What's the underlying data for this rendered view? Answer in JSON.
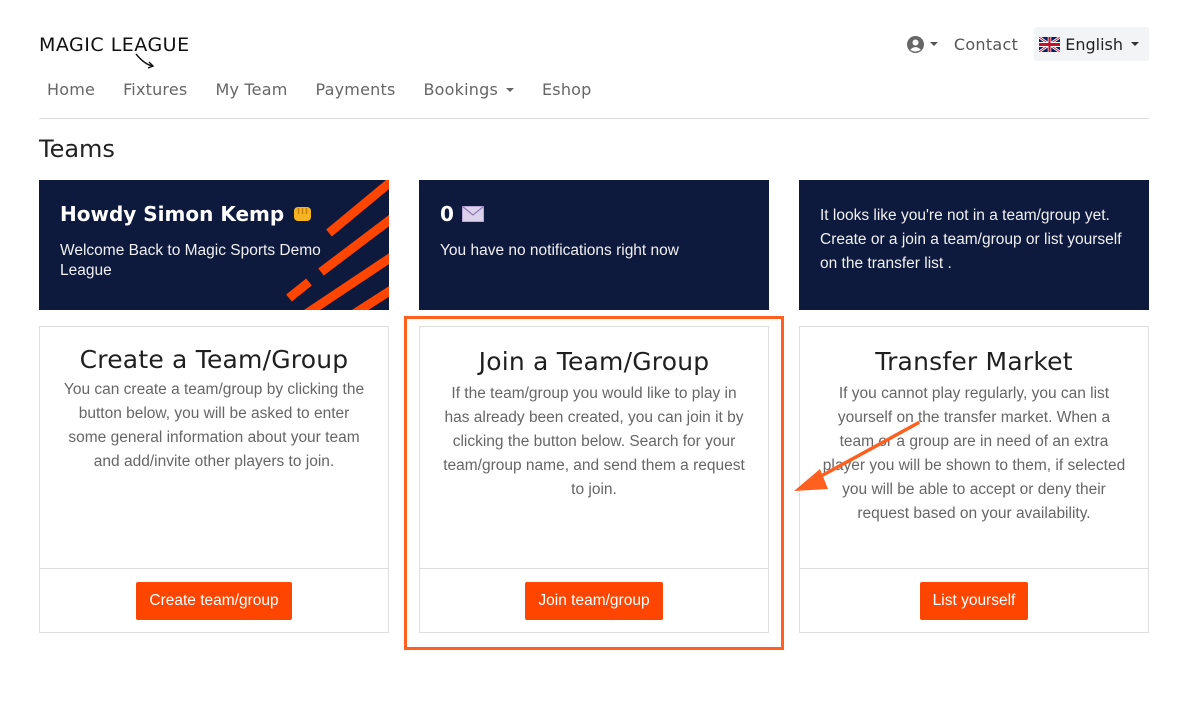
{
  "header": {
    "logo_text": "MAGIC LEAGUE",
    "contact_label": "Contact",
    "language": "English"
  },
  "nav": {
    "items": [
      {
        "label": "Home"
      },
      {
        "label": "Fixtures"
      },
      {
        "label": "My Team"
      },
      {
        "label": "Payments"
      },
      {
        "label": "Bookings",
        "dropdown": true
      },
      {
        "label": "Eshop"
      }
    ]
  },
  "page": {
    "title": "Teams"
  },
  "info_cards": {
    "greeting": {
      "title": "Howdy Simon Kemp",
      "icon": "fist-icon",
      "text": "Welcome Back to Magic Sports Demo League"
    },
    "notifications": {
      "count": "0",
      "icon": "envelope-icon",
      "text": "You have no notifications right now"
    },
    "team_status": {
      "text": "It looks like you're not in a team/group yet. Create or a join a team/group or list yourself on the transfer list ."
    }
  },
  "action_cards": {
    "create": {
      "title": "Create a Team/Group",
      "text": "You can create a team/group by clicking the button below, you will be asked to enter some general information about your team and add/invite other players to join.",
      "button": "Create team/group"
    },
    "join": {
      "title": "Join a Team/Group",
      "text": "If the team/group you would like to play in has already been created, you can join it by clicking the button below. Search for your team/group name, and send them a request to join.",
      "button": "Join team/group"
    },
    "transfer": {
      "title": "Transfer Market",
      "text": "If you cannot play regularly, you can list yourself on the transfer market. When a team or a group are in need of an extra player you will be shown to them, if selected you will be able to accept or deny their request based on your availability.",
      "button": "List yourself"
    }
  },
  "colors": {
    "accent": "#ff4500",
    "navy": "#0e1a3d",
    "annotation": "#ff5f1f"
  }
}
